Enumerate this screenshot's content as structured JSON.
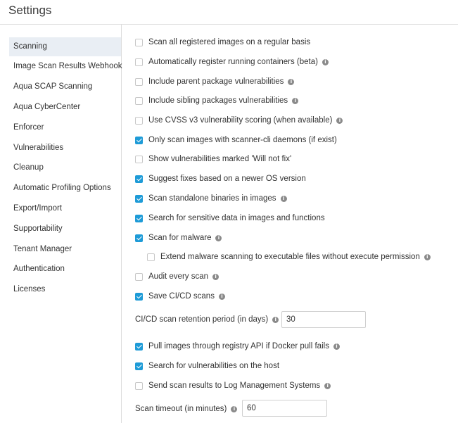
{
  "header": {
    "title": "Settings"
  },
  "sidebar": {
    "items": [
      {
        "label": "Scanning",
        "active": true
      },
      {
        "label": "Image Scan Results Webhook"
      },
      {
        "label": "Aqua SCAP Scanning"
      },
      {
        "label": "Aqua CyberCenter"
      },
      {
        "label": "Enforcer"
      },
      {
        "label": "Vulnerabilities"
      },
      {
        "label": "Cleanup"
      },
      {
        "label": "Automatic Profiling Options"
      },
      {
        "label": "Export/Import"
      },
      {
        "label": "Supportability"
      },
      {
        "label": "Tenant Manager"
      },
      {
        "label": "Authentication"
      },
      {
        "label": "Licenses"
      }
    ]
  },
  "options": {
    "scan_registered": {
      "label": "Scan all registered images on a regular basis",
      "checked": false
    },
    "auto_register": {
      "label": "Automatically register running containers (beta)",
      "checked": false
    },
    "parent_pkg": {
      "label": "Include parent package vulnerabilities",
      "checked": false
    },
    "sibling_pkg": {
      "label": "Include sibling packages vulnerabilities",
      "checked": false
    },
    "cvss_v3": {
      "label": "Use CVSS v3 vulnerability scoring (when available)",
      "checked": false
    },
    "scanner_cli": {
      "label": "Only scan images with scanner-cli daemons (if exist)",
      "checked": true
    },
    "will_not_fix": {
      "label": "Show vulnerabilities marked 'Will not fix'",
      "checked": false
    },
    "suggest_fixes": {
      "label": "Suggest fixes based on a newer OS version",
      "checked": true
    },
    "standalone_binaries": {
      "label": "Scan standalone binaries in images",
      "checked": true
    },
    "sensitive_data": {
      "label": "Search for sensitive data in images and functions",
      "checked": true
    },
    "malware": {
      "label": "Scan for malware",
      "checked": true
    },
    "extend_malware": {
      "label": "Extend malware scanning to executable files without execute permission",
      "checked": false
    },
    "audit_scan": {
      "label": "Audit every scan",
      "checked": false
    },
    "save_cicd": {
      "label": "Save CI/CD scans",
      "checked": true
    },
    "pull_registry_api": {
      "label": "Pull images through registry API if Docker pull fails",
      "checked": true
    },
    "host_vulns": {
      "label": "Search for vulnerabilities on the host",
      "checked": true
    },
    "log_mgmt": {
      "label": "Send scan results to Log Management Systems",
      "checked": false
    }
  },
  "fields": {
    "cicd_retention": {
      "label": "CI/CD scan retention period (in days)",
      "value": "30"
    },
    "scan_timeout": {
      "label": "Scan timeout (in minutes)",
      "value": "60"
    }
  },
  "colors": {
    "accent": "#1e9bd7",
    "active_bg": "#e9eef4",
    "divider": "#dcdcdc"
  }
}
